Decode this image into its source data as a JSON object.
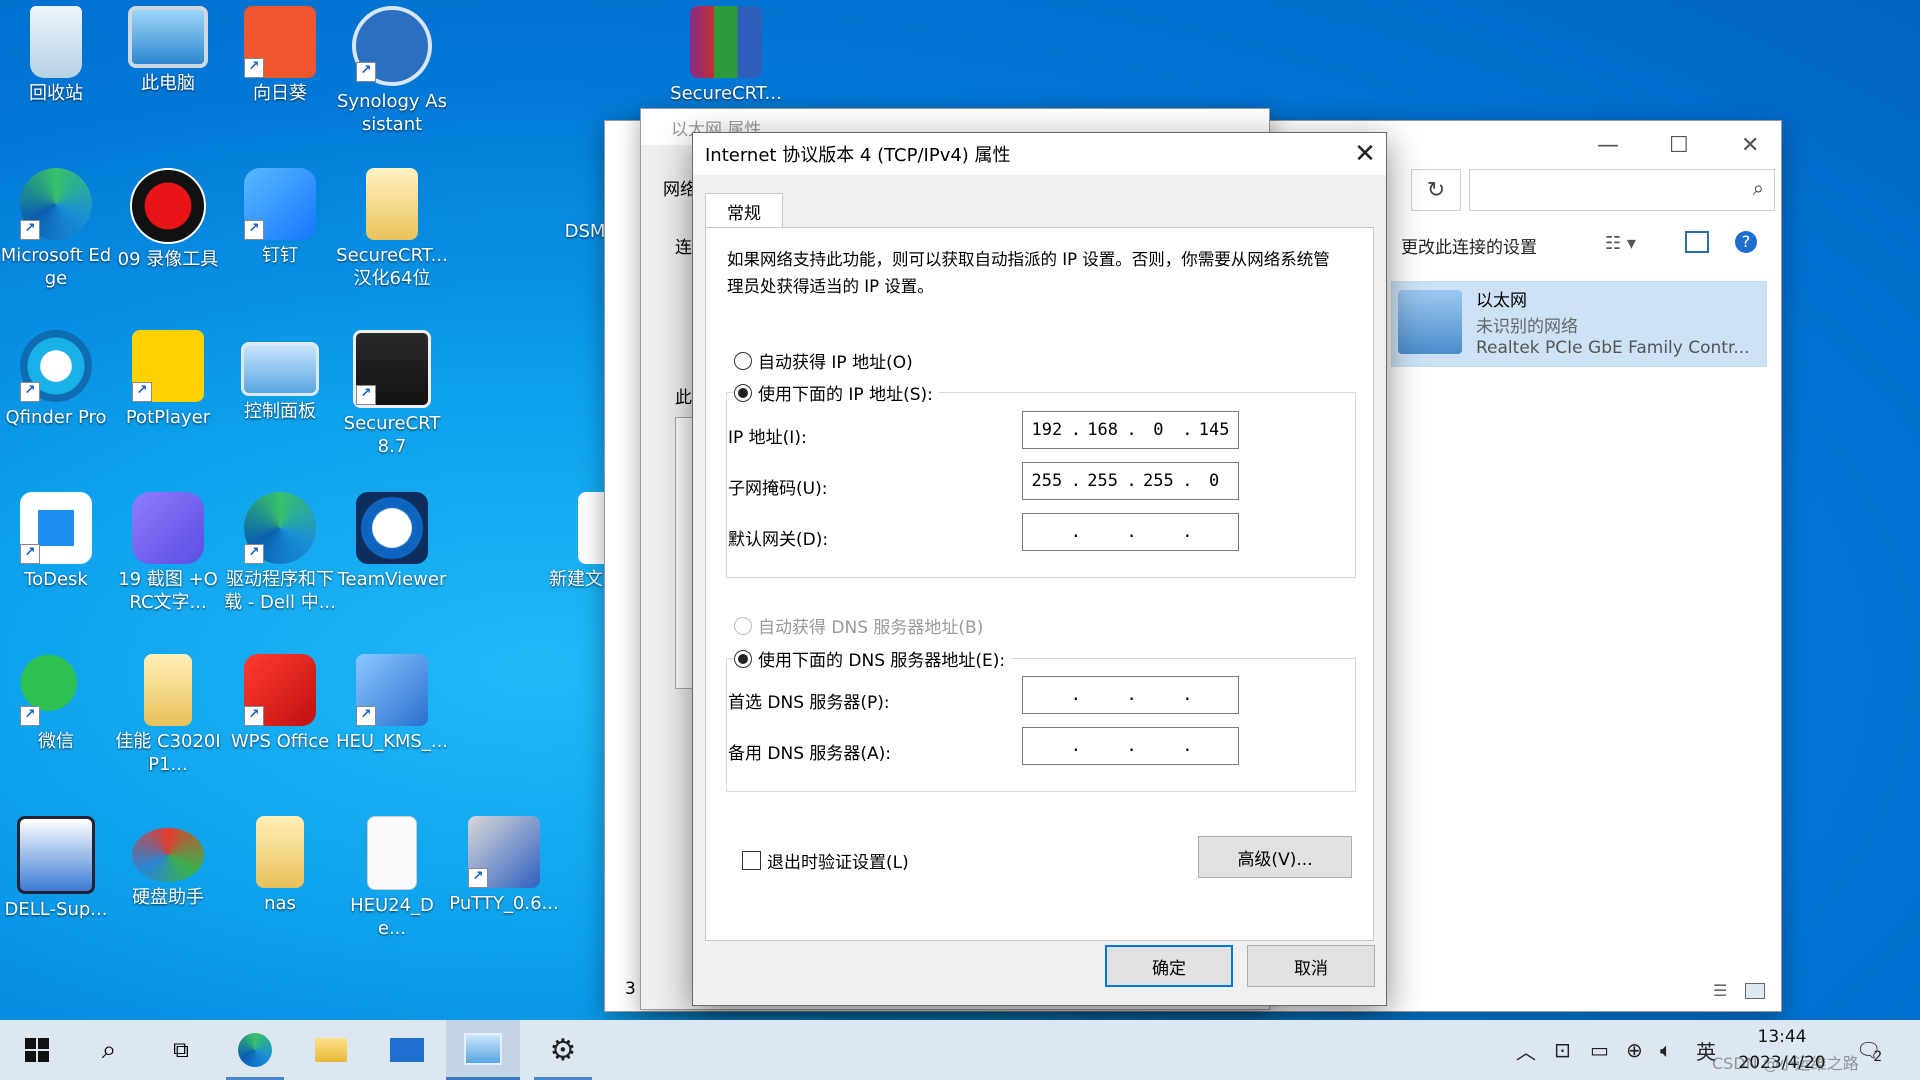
{
  "desktop": {
    "icons": [
      {
        "label": "回收站",
        "icon": "recycle-bin-icon"
      },
      {
        "label": "此电脑",
        "icon": "computer-icon"
      },
      {
        "label": "向日葵",
        "icon": "sunlogin-icon"
      },
      {
        "label": "Synology Assistant",
        "icon": "synology-icon"
      },
      {
        "label": "SecureCRT...",
        "icon": "winrar-icon"
      },
      {
        "label": "Microsoft Edge",
        "icon": "edge-icon"
      },
      {
        "label": "09 录像工具",
        "icon": "record-icon"
      },
      {
        "label": "钉钉",
        "icon": "dingtalk-icon"
      },
      {
        "label": "SecureCRT... 汉化64位",
        "icon": "folder-zip-icon"
      },
      {
        "label": "DSM",
        "icon": "dsm-icon"
      },
      {
        "label": "Qfinder Pro",
        "icon": "qfinder-icon"
      },
      {
        "label": "PotPlayer",
        "icon": "potplayer-icon"
      },
      {
        "label": "控制面板",
        "icon": "control-panel-icon"
      },
      {
        "label": "SecureCRT 8.7",
        "icon": "securecrt-icon"
      },
      {
        "label": "ToDesk",
        "icon": "todesk-icon"
      },
      {
        "label": "19 截图 +ORC文字...",
        "icon": "panda-icon"
      },
      {
        "label": "驱动程序和下载 - Dell 中...",
        "icon": "edge-icon"
      },
      {
        "label": "TeamViewer",
        "icon": "teamviewer-icon"
      },
      {
        "label": "新建文",
        "icon": "new-file-icon"
      },
      {
        "label": "微信",
        "icon": "wechat-icon"
      },
      {
        "label": "佳能 C3020IP1...",
        "icon": "folder-icon"
      },
      {
        "label": "WPS Office",
        "icon": "wps-icon"
      },
      {
        "label": "HEU_KMS_...",
        "icon": "heu-kms-icon"
      },
      {
        "label": "DELL-Sup...",
        "icon": "dell-support-icon"
      },
      {
        "label": "硬盘助手",
        "icon": "disk-helper-icon"
      },
      {
        "label": "nas",
        "icon": "folder-icon"
      },
      {
        "label": "HEU24_De...",
        "icon": "document-icon"
      },
      {
        "label": "PuTTY_0.6...",
        "icon": "putty-icon"
      }
    ]
  },
  "explorer": {
    "search_placeholder": "",
    "command_label": "更改此连接的设置",
    "adapter": {
      "name": "以太网",
      "status": "未识别的网络",
      "device": "Realtek PCIe GbE Family Contr..."
    },
    "status_count": "3"
  },
  "ethernet_props": {
    "title": "以太网 属性",
    "tab": "网络",
    "connect_label": "连",
    "this_label": "此"
  },
  "dialog": {
    "title": "Internet 协议版本 4 (TCP/IPv4) 属性",
    "tab": "常规",
    "description": "如果网络支持此功能，则可以获取自动指派的 IP 设置。否则，你需要从网络系统管理员处获得适当的 IP 设置。",
    "auto_ip_label": "自动获得 IP 地址(O)",
    "manual_ip_label": "使用下面的 IP 地址(S):",
    "ip_label": "IP 地址(I):",
    "ip_value": [
      "192",
      "168",
      "0",
      "145"
    ],
    "mask_label": "子网掩码(U):",
    "mask_value": [
      "255",
      "255",
      "255",
      "0"
    ],
    "gateway_label": "默认网关(D):",
    "gateway_value": [
      "",
      "",
      "",
      ""
    ],
    "auto_dns_label": "自动获得 DNS 服务器地址(B)",
    "manual_dns_label": "使用下面的 DNS 服务器地址(E):",
    "dns1_label": "首选 DNS 服务器(P):",
    "dns1_value": [
      "",
      "",
      "",
      ""
    ],
    "dns2_label": "备用 DNS 服务器(A):",
    "dns2_value": [
      "",
      "",
      "",
      ""
    ],
    "validate_label": "退出时验证设置(L)",
    "advanced_label": "高级(V)...",
    "ok_label": "确定",
    "cancel_label": "取消"
  },
  "taskbar": {
    "clock_time": "13:44",
    "clock_date": "2023/4/20",
    "ime": "英",
    "notification_count": "2",
    "watermark": "CSDN @小运维之路"
  },
  "colors": {
    "accent": "#0078d7",
    "taskbar": "#dce7f2"
  }
}
